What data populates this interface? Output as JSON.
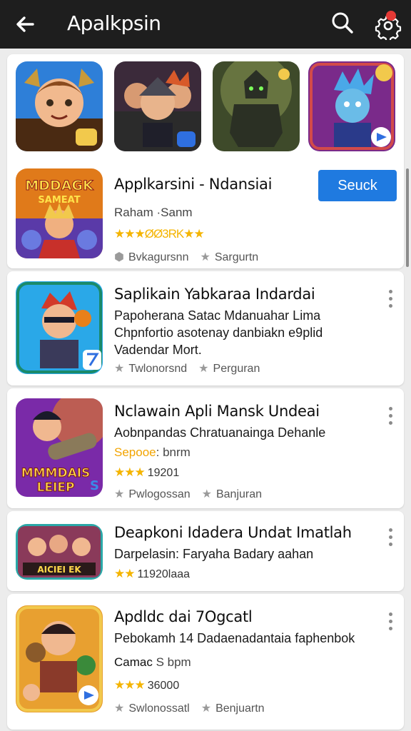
{
  "header": {
    "title": "Apalkpsin",
    "icons": [
      "back-arrow-icon",
      "search-icon",
      "settings-icon"
    ]
  },
  "featured": {
    "items": [
      {
        "art": "hero-boy-horned-helmet"
      },
      {
        "art": "ninja-squad"
      },
      {
        "art": "armored-knight"
      },
      {
        "art": "blue-ninja-hero"
      }
    ]
  },
  "apps": [
    {
      "icon_text": "MDDAGK SAMEAT",
      "title": "Applkarsini - Ndansiai",
      "subtitle": "Raham ·Sanm",
      "rating_text": "★★★ØØ3RK★★",
      "meta1": "Bvkagursnn",
      "meta2": "Sargurtn",
      "action_label": "Seuck"
    },
    {
      "title": "Saplikain Yabkaraa Indardai",
      "description": "Papoherana Satac Mdanuahar Lima Chpnfortio asotenay danbiakn e9plid Vadendar Mort.",
      "meta1": "Twlonorsnd",
      "meta2": "Perguran"
    },
    {
      "icon_text": "MMMDAIS LEIEP",
      "title": "Nclawain Apli Mansk Undeai",
      "description": "Aobnpandas Chratuanainga Dehanle",
      "subtitle_accent": "Sepooe",
      "subtitle_rest": ": bnrm",
      "rating_text": "19201",
      "meta1": "Pwlogossan",
      "meta2": "Banjuran"
    },
    {
      "icon_text": "AICIEI EK",
      "title": "Deapkoni Idadera Undat Imatlah",
      "description": "Darpelasin: Faryaha Badary aahan",
      "rating_text": "11920laaa"
    },
    {
      "title": "Apdldc dai 7Ogcatl",
      "description": "Pebokamh 14 Dadaenadantaia faphenbok",
      "subtitle_strong": "Camac",
      "subtitle_rest": "  S bpm",
      "rating_text": "36000",
      "meta1": "Swlonossatl",
      "meta2": "Benjuartn"
    }
  ],
  "colors": {
    "topbar": "#1e1e1e",
    "accent_button": "#1f7ae0",
    "star": "#f4b400",
    "notification": "#e53935"
  }
}
